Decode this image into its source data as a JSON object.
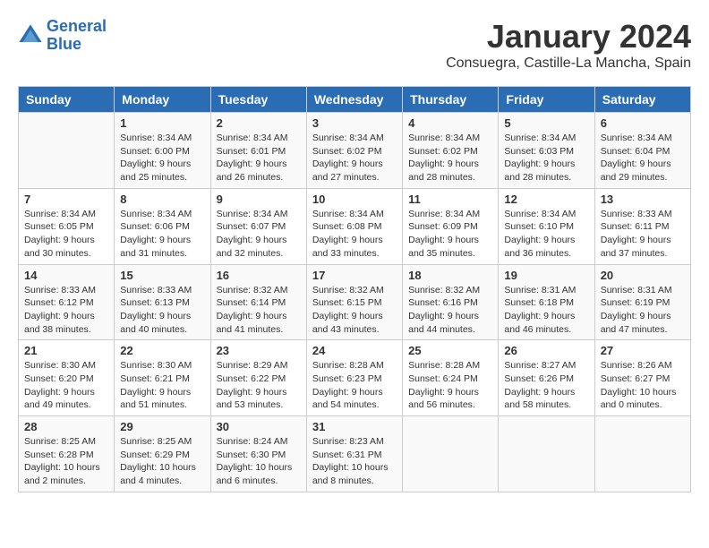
{
  "header": {
    "logo_line1": "General",
    "logo_line2": "Blue",
    "title": "January 2024",
    "subtitle": "Consuegra, Castille-La Mancha, Spain"
  },
  "days_of_week": [
    "Sunday",
    "Monday",
    "Tuesday",
    "Wednesday",
    "Thursday",
    "Friday",
    "Saturday"
  ],
  "weeks": [
    [
      {
        "day": "",
        "data": ""
      },
      {
        "day": "1",
        "data": "Sunrise: 8:34 AM\nSunset: 6:00 PM\nDaylight: 9 hours\nand 25 minutes."
      },
      {
        "day": "2",
        "data": "Sunrise: 8:34 AM\nSunset: 6:01 PM\nDaylight: 9 hours\nand 26 minutes."
      },
      {
        "day": "3",
        "data": "Sunrise: 8:34 AM\nSunset: 6:02 PM\nDaylight: 9 hours\nand 27 minutes."
      },
      {
        "day": "4",
        "data": "Sunrise: 8:34 AM\nSunset: 6:02 PM\nDaylight: 9 hours\nand 28 minutes."
      },
      {
        "day": "5",
        "data": "Sunrise: 8:34 AM\nSunset: 6:03 PM\nDaylight: 9 hours\nand 28 minutes."
      },
      {
        "day": "6",
        "data": "Sunrise: 8:34 AM\nSunset: 6:04 PM\nDaylight: 9 hours\nand 29 minutes."
      }
    ],
    [
      {
        "day": "7",
        "data": "Sunrise: 8:34 AM\nSunset: 6:05 PM\nDaylight: 9 hours\nand 30 minutes."
      },
      {
        "day": "8",
        "data": "Sunrise: 8:34 AM\nSunset: 6:06 PM\nDaylight: 9 hours\nand 31 minutes."
      },
      {
        "day": "9",
        "data": "Sunrise: 8:34 AM\nSunset: 6:07 PM\nDaylight: 9 hours\nand 32 minutes."
      },
      {
        "day": "10",
        "data": "Sunrise: 8:34 AM\nSunset: 6:08 PM\nDaylight: 9 hours\nand 33 minutes."
      },
      {
        "day": "11",
        "data": "Sunrise: 8:34 AM\nSunset: 6:09 PM\nDaylight: 9 hours\nand 35 minutes."
      },
      {
        "day": "12",
        "data": "Sunrise: 8:34 AM\nSunset: 6:10 PM\nDaylight: 9 hours\nand 36 minutes."
      },
      {
        "day": "13",
        "data": "Sunrise: 8:33 AM\nSunset: 6:11 PM\nDaylight: 9 hours\nand 37 minutes."
      }
    ],
    [
      {
        "day": "14",
        "data": "Sunrise: 8:33 AM\nSunset: 6:12 PM\nDaylight: 9 hours\nand 38 minutes."
      },
      {
        "day": "15",
        "data": "Sunrise: 8:33 AM\nSunset: 6:13 PM\nDaylight: 9 hours\nand 40 minutes."
      },
      {
        "day": "16",
        "data": "Sunrise: 8:32 AM\nSunset: 6:14 PM\nDaylight: 9 hours\nand 41 minutes."
      },
      {
        "day": "17",
        "data": "Sunrise: 8:32 AM\nSunset: 6:15 PM\nDaylight: 9 hours\nand 43 minutes."
      },
      {
        "day": "18",
        "data": "Sunrise: 8:32 AM\nSunset: 6:16 PM\nDaylight: 9 hours\nand 44 minutes."
      },
      {
        "day": "19",
        "data": "Sunrise: 8:31 AM\nSunset: 6:18 PM\nDaylight: 9 hours\nand 46 minutes."
      },
      {
        "day": "20",
        "data": "Sunrise: 8:31 AM\nSunset: 6:19 PM\nDaylight: 9 hours\nand 47 minutes."
      }
    ],
    [
      {
        "day": "21",
        "data": "Sunrise: 8:30 AM\nSunset: 6:20 PM\nDaylight: 9 hours\nand 49 minutes."
      },
      {
        "day": "22",
        "data": "Sunrise: 8:30 AM\nSunset: 6:21 PM\nDaylight: 9 hours\nand 51 minutes."
      },
      {
        "day": "23",
        "data": "Sunrise: 8:29 AM\nSunset: 6:22 PM\nDaylight: 9 hours\nand 53 minutes."
      },
      {
        "day": "24",
        "data": "Sunrise: 8:28 AM\nSunset: 6:23 PM\nDaylight: 9 hours\nand 54 minutes."
      },
      {
        "day": "25",
        "data": "Sunrise: 8:28 AM\nSunset: 6:24 PM\nDaylight: 9 hours\nand 56 minutes."
      },
      {
        "day": "26",
        "data": "Sunrise: 8:27 AM\nSunset: 6:26 PM\nDaylight: 9 hours\nand 58 minutes."
      },
      {
        "day": "27",
        "data": "Sunrise: 8:26 AM\nSunset: 6:27 PM\nDaylight: 10 hours\nand 0 minutes."
      }
    ],
    [
      {
        "day": "28",
        "data": "Sunrise: 8:25 AM\nSunset: 6:28 PM\nDaylight: 10 hours\nand 2 minutes."
      },
      {
        "day": "29",
        "data": "Sunrise: 8:25 AM\nSunset: 6:29 PM\nDaylight: 10 hours\nand 4 minutes."
      },
      {
        "day": "30",
        "data": "Sunrise: 8:24 AM\nSunset: 6:30 PM\nDaylight: 10 hours\nand 6 minutes."
      },
      {
        "day": "31",
        "data": "Sunrise: 8:23 AM\nSunset: 6:31 PM\nDaylight: 10 hours\nand 8 minutes."
      },
      {
        "day": "",
        "data": ""
      },
      {
        "day": "",
        "data": ""
      },
      {
        "day": "",
        "data": ""
      }
    ]
  ]
}
